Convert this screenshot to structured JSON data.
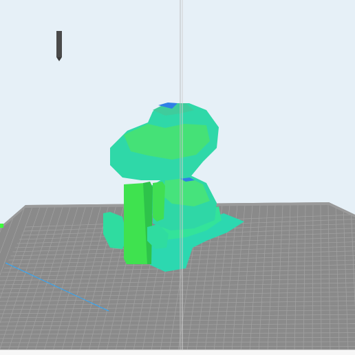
{
  "viewport": {
    "background_color": "#e6f0f7",
    "build_plate_color": "#8a8a8a",
    "grid_line_color": "#a9a9a9",
    "mesh_color_primary": "#2fdca0",
    "mesh_color_secondary": "#49e854",
    "mesh_color_overhang": "#2f7fe6",
    "axis_x_color": "#2aa8ff",
    "axis_y_color": "#3cff3c",
    "icons": [
      "viewport-canvas",
      "build-plate",
      "center-guide-line",
      "camera-marker-icon",
      "model-mesh",
      "support-pillar",
      "x-axis-line",
      "y-axis-marker"
    ]
  },
  "status_bar": {
    "text": ""
  }
}
